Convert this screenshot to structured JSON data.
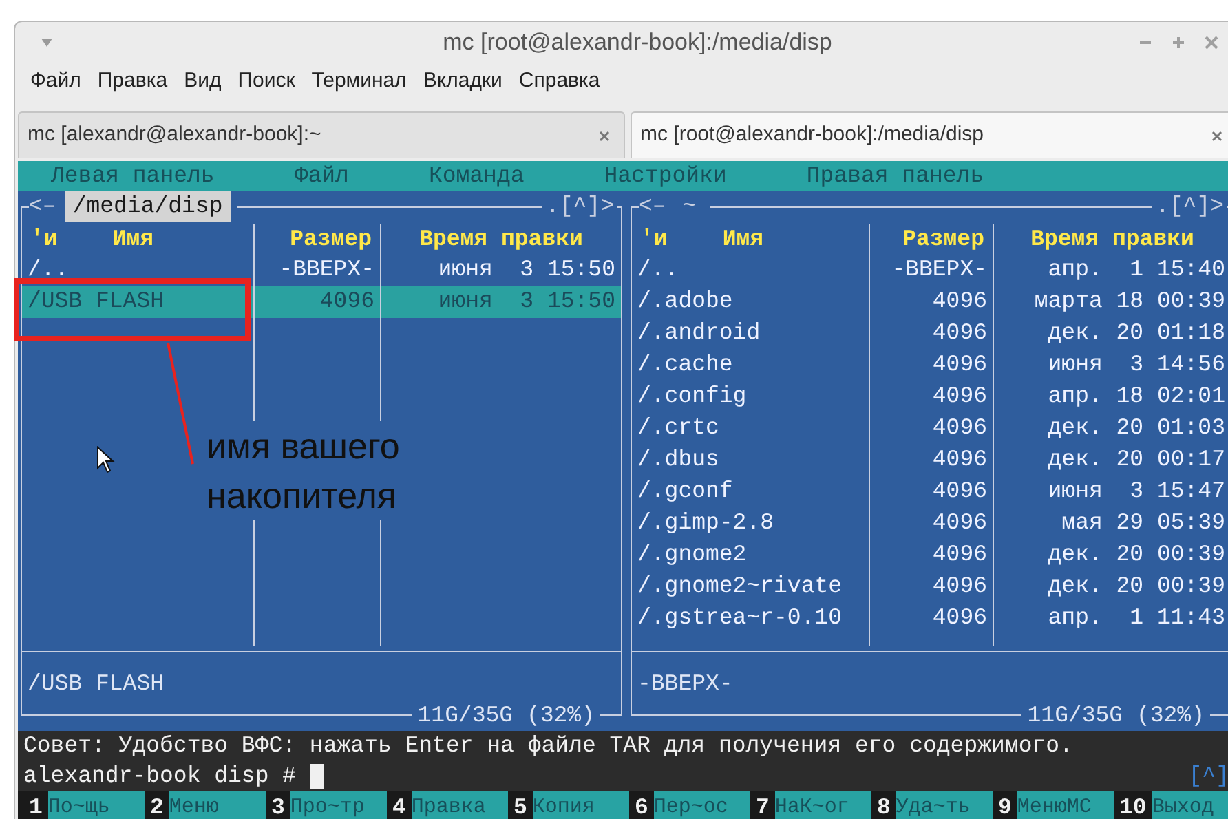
{
  "window": {
    "title": "mc [root@alexandr-book]:/media/disp"
  },
  "menu": [
    "Файл",
    "Правка",
    "Вид",
    "Поиск",
    "Терминал",
    "Вкладки",
    "Справка"
  ],
  "tabs": [
    {
      "label": "mc [alexandr@alexandr-book]:~",
      "selected": false
    },
    {
      "label": "mc [root@alexandr-book]:/media/disp",
      "selected": true
    }
  ],
  "terminal": {
    "top_menu": [
      "Левая панель",
      "Файл",
      "Команда",
      "Настройки",
      "Правая панель"
    ],
    "panels": [
      {
        "nav": "<–",
        "path": "/media/disp",
        "active": true,
        "marker": ".[^]>",
        "columns": [
          "'и",
          "Имя",
          "Размер",
          "Время правки"
        ],
        "rows": [
          {
            "name": "/..",
            "size": "-ВВЕРХ-",
            "date": "июня  3 15:50",
            "selected": false
          },
          {
            "name": "/USB FLASH",
            "size": "4096",
            "date": "июня  3 15:50",
            "selected": true
          }
        ],
        "mini_status": "/USB FLASH",
        "disk_usage": "11G/35G (32%)"
      },
      {
        "nav": "<–",
        "path": "~",
        "active": false,
        "marker": ".[^]>",
        "columns": [
          "'и",
          "Имя",
          "Размер",
          "Время правки"
        ],
        "rows": [
          {
            "name": "/..",
            "size": "-ВВЕРХ-",
            "date": "апр.  1 15:40",
            "selected": false
          },
          {
            "name": "/.adobe",
            "size": "4096",
            "date": "марта 18 00:39",
            "selected": false
          },
          {
            "name": "/.android",
            "size": "4096",
            "date": "дек. 20 01:18",
            "selected": false
          },
          {
            "name": "/.cache",
            "size": "4096",
            "date": "июня  3 14:56",
            "selected": false
          },
          {
            "name": "/.config",
            "size": "4096",
            "date": "апр. 18 02:01",
            "selected": false
          },
          {
            "name": "/.crtc",
            "size": "4096",
            "date": "дек. 20 01:03",
            "selected": false
          },
          {
            "name": "/.dbus",
            "size": "4096",
            "date": "дек. 20 00:17",
            "selected": false
          },
          {
            "name": "/.gconf",
            "size": "4096",
            "date": "июня  3 15:47",
            "selected": false
          },
          {
            "name": "/.gimp-2.8",
            "size": "4096",
            "date": "мая 29 05:39",
            "selected": false
          },
          {
            "name": "/.gnome2",
            "size": "4096",
            "date": "дек. 20 00:39",
            "selected": false
          },
          {
            "name": "/.gnome2~rivate",
            "size": "4096",
            "date": "дек. 20 00:39",
            "selected": false
          },
          {
            "name": "/.gstrea~r-0.10",
            "size": "4096",
            "date": "апр.  1 11:43",
            "selected": false
          }
        ],
        "mini_status": "-ВВЕРХ-",
        "disk_usage": "11G/35G (32%)"
      }
    ],
    "hint": "Совет: Удобство ВФС: нажать Enter на файле TAR для получения его содержимого.",
    "prompt": "alexandr-book disp #",
    "prompt_marker": "[^]",
    "function_keys": [
      {
        "number": "1",
        "label": "По~щь"
      },
      {
        "number": "2",
        "label": "Меню"
      },
      {
        "number": "3",
        "label": "Про~тр"
      },
      {
        "number": "4",
        "label": "Правка"
      },
      {
        "number": "5",
        "label": "Копия"
      },
      {
        "number": "6",
        "label": "Пер~ос"
      },
      {
        "number": "7",
        "label": "НаК~ог"
      },
      {
        "number": "8",
        "label": "Уда~ть"
      },
      {
        "number": "9",
        "label": "МенюМС"
      },
      {
        "number": "10",
        "label": "Выход"
      }
    ]
  },
  "annotation": {
    "text": "имя вашего накопителя"
  }
}
